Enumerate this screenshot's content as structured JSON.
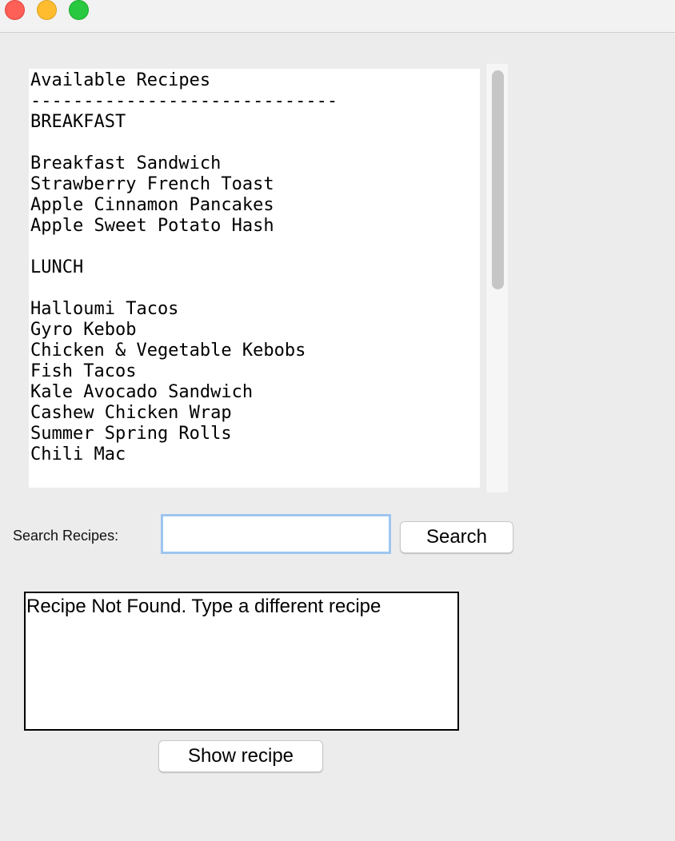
{
  "window": {
    "controls": [
      "close",
      "minimize",
      "zoom"
    ]
  },
  "recipe_list": {
    "lines": [
      "Available Recipes",
      "-----------------------------",
      "BREAKFAST",
      "",
      "Breakfast Sandwich",
      "Strawberry French Toast",
      "Apple Cinnamon Pancakes",
      "Apple Sweet Potato Hash",
      "",
      "LUNCH",
      "",
      "Halloumi Tacos",
      "Gyro Kebob",
      "Chicken & Vegetable Kebobs",
      "Fish Tacos",
      "Kale Avocado Sandwich",
      "Cashew Chicken Wrap",
      "Summer Spring Rolls",
      "Chili Mac"
    ]
  },
  "search": {
    "label": "Search Recipes:",
    "value": "",
    "button_label": "Search"
  },
  "result": {
    "text": "Recipe Not Found. Type a different recipe"
  },
  "show_recipe": {
    "button_label": "Show recipe"
  },
  "colors": {
    "background": "#ececec",
    "close": "#fe5f57",
    "minimize": "#febc2e",
    "zoom": "#28c840",
    "focus_ring": "#9fc5ef"
  }
}
